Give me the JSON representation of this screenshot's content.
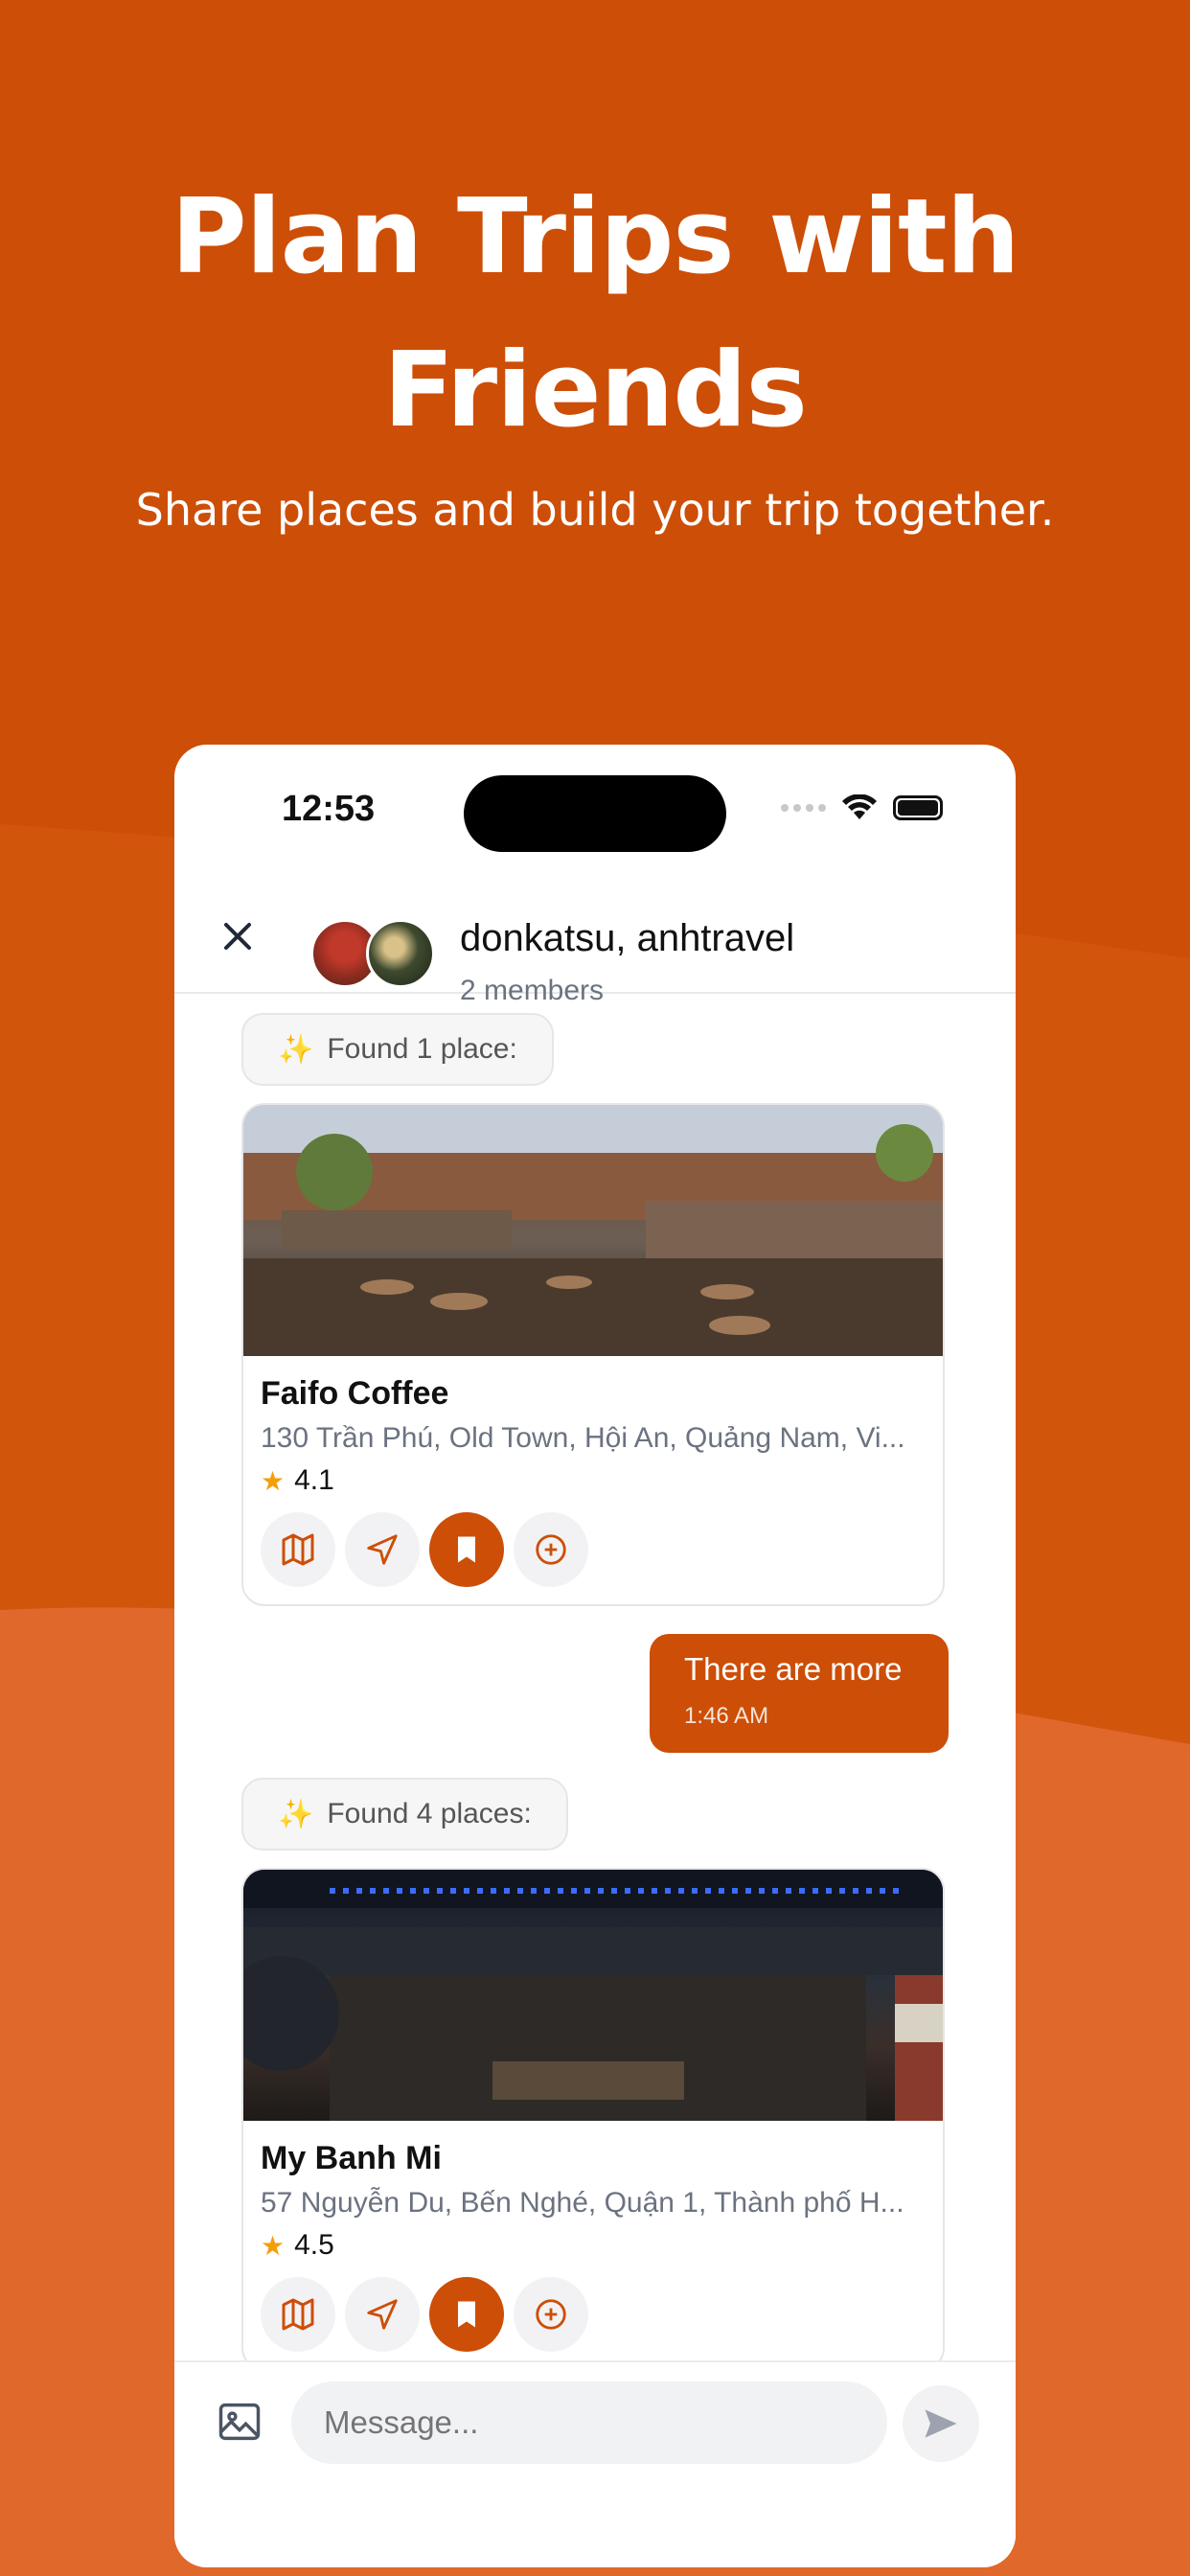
{
  "headline": "Plan Trips with Friends",
  "subheadline": "Share places and build your trip together.",
  "status_bar": {
    "time": "12:53"
  },
  "chat": {
    "title": "donkatsu, anhtravel",
    "subtitle": "2 members"
  },
  "messages": [
    {
      "found_label": "Found 1 place:",
      "places": [
        {
          "name": "Faifo Coffee",
          "address": "130 Trần Phú, Old Town, Hội An, Quảng Nam, Vi...",
          "rating": "4.1"
        }
      ]
    },
    {
      "outgoing_text": "There are more",
      "outgoing_time": "1:46 AM"
    },
    {
      "found_label": "Found 4 places:",
      "places": [
        {
          "name": "My Banh Mi",
          "address": "57 Nguyễn Du, Bến Nghé, Quận 1, Thành phố H...",
          "rating": "4.5"
        }
      ]
    }
  ],
  "composer": {
    "placeholder": "Message..."
  },
  "icons": {
    "close": "close-icon",
    "map": "map-icon",
    "navigate": "navigation-arrow-icon",
    "bookmark": "bookmark-icon",
    "add": "plus-circle-icon",
    "image": "image-icon",
    "send": "send-icon",
    "star": "star-icon",
    "sparkles": "sparkles-icon",
    "wifi": "wifi-icon",
    "battery": "battery-icon"
  },
  "colors": {
    "brand": "#cd4e07",
    "background": "#cd4e07",
    "star": "#f59e0b"
  }
}
